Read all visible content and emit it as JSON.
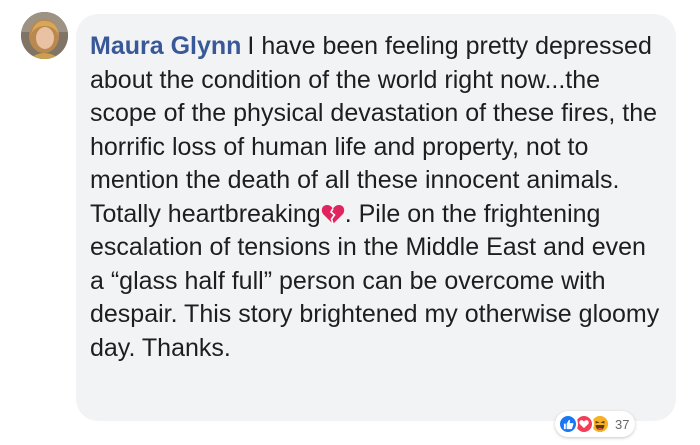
{
  "comment": {
    "author": "Maura Glynn",
    "text_part1": "I have been feeling pretty depressed about the condition of the world right now...the scope of the physical devastation of these fires, the horrific loss of human life and property, not to mention the death of all these innocent animals. Totally heartbreaking",
    "text_part2": ". Pile on the frightening escalation of tensions in the Middle East and even a “glass half full” person can be overcome with despair. This story brightened my otherwise gloomy day. Thanks."
  },
  "reactions": {
    "icons": [
      "like-icon",
      "love-icon",
      "haha-icon"
    ],
    "count": "37"
  },
  "colors": {
    "author": "#385898",
    "bubble": "#f2f3f5",
    "text": "#1c1e21",
    "like": "#1877f2",
    "love": "#f33e58",
    "haha": "#f7b125"
  }
}
